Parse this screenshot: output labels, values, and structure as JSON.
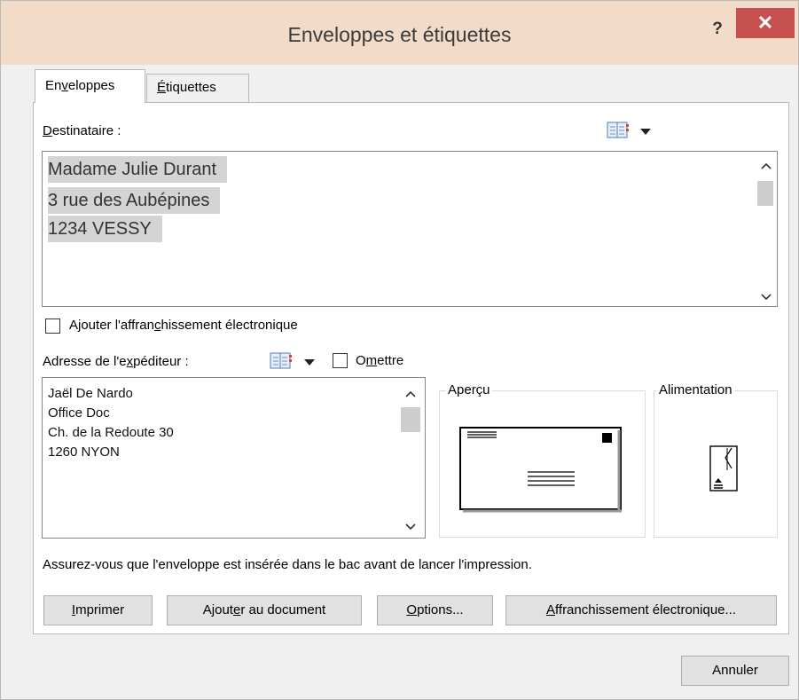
{
  "window": {
    "title": "Enveloppes et étiquettes",
    "help_label": "?",
    "close_label": "✕"
  },
  "tabs": [
    {
      "pre": "En",
      "key": "v",
      "post": "eloppes"
    },
    {
      "pre": "",
      "key": "É",
      "post": "tiquettes"
    }
  ],
  "recipient": {
    "label_key": "D",
    "label_rest": "estinataire :",
    "lines": [
      "Madame Julie Durant",
      "3 rue des Aubépines",
      "1234 VESSY"
    ]
  },
  "electronic_postage_checkbox": {
    "pre": "Ajouter l'affran",
    "key": "c",
    "post": "hissement électronique",
    "checked": false
  },
  "sender": {
    "label_pre": "Adresse de l'e",
    "label_key": "x",
    "label_post": "péditeur :",
    "omit": {
      "pre": "O",
      "key": "m",
      "post": "ettre",
      "checked": false
    },
    "lines": [
      "Jaël De Nardo",
      "Office Doc",
      "Ch. de la Redoute 30",
      "1260 NYON"
    ]
  },
  "preview": {
    "legend": "Aperçu"
  },
  "feed": {
    "legend": "Alimentation"
  },
  "notice": "Assurez-vous que l'enveloppe est insérée dans le bac avant de lancer l'impression.",
  "buttons": {
    "print": {
      "key": "I",
      "rest": "mprimer"
    },
    "add_to_document": {
      "pre": "Ajout",
      "key": "e",
      "post": "r au document"
    },
    "options": {
      "key": "O",
      "rest": "ptions..."
    },
    "e_postage": {
      "key": "A",
      "rest": "ffranchissement électronique..."
    },
    "cancel": "Annuler"
  },
  "icons": [
    "address-book-icon",
    "dropdown-arrow-icon",
    "scroll-up-icon",
    "scroll-down-icon",
    "envelope-preview-icon",
    "envelope-feed-icon"
  ],
  "colors": {
    "titlebar": "#f2dcc9",
    "close_button": "#c75050",
    "selection": "#d4d4d4"
  }
}
